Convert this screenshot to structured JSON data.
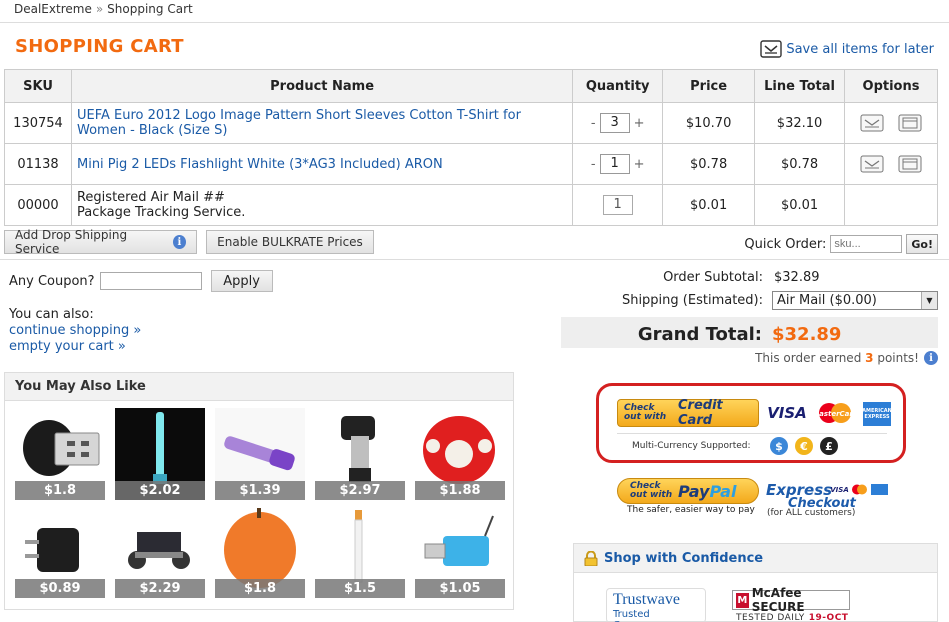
{
  "breadcrumb": {
    "home": "DealExtreme",
    "separator": "»",
    "current": "Shopping Cart"
  },
  "page": {
    "title": "SHOPPING CART",
    "save_all_label": "Save all items for later"
  },
  "cart": {
    "columns": [
      "SKU",
      "Product Name",
      "Quantity",
      "Price",
      "Line Total",
      "Options"
    ],
    "rows": [
      {
        "sku": "130754",
        "name": "UEFA Euro 2012 Logo Image Pattern Short Sleeves Cotton T-Shirt for Women - Black (Size S)",
        "qty": "3",
        "price": "$10.70",
        "total": "$32.10"
      },
      {
        "sku": "01138",
        "name": "Mini Pig 2 LEDs Flashlight White (3*AG3 Included) ARON",
        "qty": "1",
        "price": "$0.78",
        "total": "$0.78"
      },
      {
        "sku": "00000",
        "name_line1": "Registered Air Mail ##",
        "name_line2": "Package Tracking Service.",
        "qty": "1",
        "price": "$0.01",
        "total": "$0.01"
      }
    ],
    "minus": "-",
    "plus": "+"
  },
  "actions": {
    "drop_shipping": "Add Drop Shipping Service",
    "bulkrate": "Enable BULKRATE Prices",
    "info": "i"
  },
  "quick_order": {
    "label": "Quick Order:",
    "placeholder": "sku...",
    "go": "Go!"
  },
  "coupon": {
    "label": "Any Coupon?",
    "apply": "Apply"
  },
  "also": {
    "label": "You can also:",
    "continue": "continue shopping »",
    "empty": "empty your cart »"
  },
  "totals": {
    "subtotal_label": "Order Subtotal:",
    "subtotal": "$32.89",
    "shipping_label": "Shipping (Estimated):",
    "shipping_option": "Air Mail ($0.00)",
    "grand_label": "Grand Total:",
    "grand": "$32.89",
    "points_prefix": "This order earned",
    "points": "3",
    "points_suffix": "points!"
  },
  "checkout": {
    "cc_small": "Check out with",
    "cc_big": "Credit Card",
    "visa": "VISA",
    "mastercard": "MasterCard",
    "amex": "AMERICAN EXPRESS",
    "multi_currency": "Multi-Currency Supported:",
    "currencies": [
      "$",
      "€",
      "£"
    ],
    "paypal_small": "Check out with",
    "paypal_pay": "Pay",
    "paypal_pal": "Pal",
    "paypal_tag": "The safer, easier way to pay",
    "express_1": "Express",
    "express_2": "Checkout",
    "express_sub": "(for ALL customers)",
    "mini_visa": "VISA"
  },
  "confidence": {
    "title": "Shop with Confidence",
    "trustwave": "Trustwave",
    "trustwave_sub": "Trusted Commerce",
    "mcafee": "McAfee SECURE",
    "mcafee_sub": "TESTED DAILY",
    "mcafee_date": "19-OCT"
  },
  "also_like": {
    "title": "You May Also Like",
    "items": [
      {
        "price": "$1.8",
        "icon": "bluetooth-dongle"
      },
      {
        "price": "$2.02",
        "icon": "glow-stick"
      },
      {
        "price": "$1.39",
        "icon": "uv-pen"
      },
      {
        "price": "$2.97",
        "icon": "torch-lighter"
      },
      {
        "price": "$1.88",
        "icon": "mushroom-plush"
      },
      {
        "price": "$0.89",
        "icon": "plug-adapter"
      },
      {
        "price": "$2.29",
        "icon": "solar-car"
      },
      {
        "price": "$1.8",
        "icon": "apple-notepad"
      },
      {
        "price": "$1.5",
        "icon": "e-cigarette"
      },
      {
        "price": "$1.05",
        "icon": "card-reader"
      }
    ]
  },
  "colors": {
    "accent": "#f26a10",
    "link": "#1a5aa6",
    "highlight_border": "#d42020"
  }
}
